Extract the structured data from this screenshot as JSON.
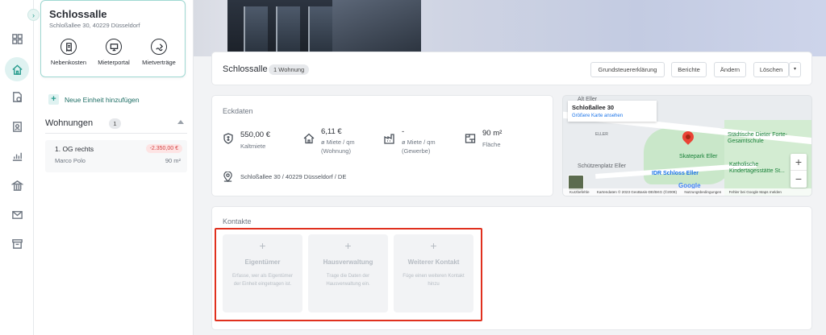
{
  "property": {
    "name": "Schlossalle",
    "address": "Schloßallee 30, 40229 Düsseldorf",
    "quick_actions": [
      {
        "label": "Nebenkosten",
        "icon": "receipt-icon"
      },
      {
        "label": "Mieterportal",
        "icon": "monitor-icon"
      },
      {
        "label": "Mietverträge",
        "icon": "contract-icon"
      }
    ]
  },
  "sidebar": {
    "add_unit_label": "Neue Einheit hinzufügen",
    "units_title": "Wohnungen",
    "units_count": "1",
    "units": [
      {
        "name": "1. OG rechts",
        "tenant": "Marco Polo",
        "balance": "-2.350,00 €",
        "area": "90 m²"
      }
    ]
  },
  "header": {
    "title": "Schlossalle",
    "badge": "1 Wohnung",
    "buttons": [
      "Grundsteuererklärung",
      "Berichte",
      "Ändern",
      "Löschen"
    ],
    "more_icon": "caret-down-icon"
  },
  "eckdaten": {
    "title": "Eckdaten",
    "metrics": [
      {
        "value": "550,00 €",
        "label": "Kaltmiete",
        "icon": "money-shield-icon"
      },
      {
        "value": "6,11 €",
        "label": "ø Miete / qm\n(Wohnung)",
        "icon": "house-icon"
      },
      {
        "value": "-",
        "label": "ø Miete / qm\n(Gewerbe)",
        "icon": "factory-icon"
      },
      {
        "value": "90 m²",
        "label": "Fläche",
        "icon": "area-icon"
      }
    ],
    "address": "Schloßallee 30 / 40229 Düsseldorf / DE"
  },
  "map": {
    "place": "Schloßallee 30",
    "link": "Größere Karte ansehen",
    "pois": [
      "Städtische Dieter Forte-Gesamtschule",
      "Skatepark Eller",
      "Schützenplatz Eller",
      "IDR Schloss Eller",
      "Katholische Kindertagesstätte St...",
      "Alt Eller",
      "ELLER"
    ],
    "google": "Google",
    "attribution": [
      "Kurzbefehle",
      "Kartendaten © 2023 GeoBasis-DE/BKG (©2009)",
      "Nutzungsbedingungen",
      "Fehler bei Google Maps melden"
    ]
  },
  "kontakte": {
    "title": "Kontakte",
    "items": [
      {
        "title": "Eigentümer",
        "desc": "Erfasse, wer als Eigentümer der Einheit eingetragen ist."
      },
      {
        "title": "Hausverwaltung",
        "desc": "Trage die Daten der Hausverwaltung ein."
      },
      {
        "title": "Weiterer Kontakt",
        "desc": "Füge einen weiteren Kontakt hinzu"
      }
    ]
  },
  "colors": {
    "accent": "#2a9d8f",
    "danger": "#d64545",
    "highlight": "#e0301e"
  }
}
